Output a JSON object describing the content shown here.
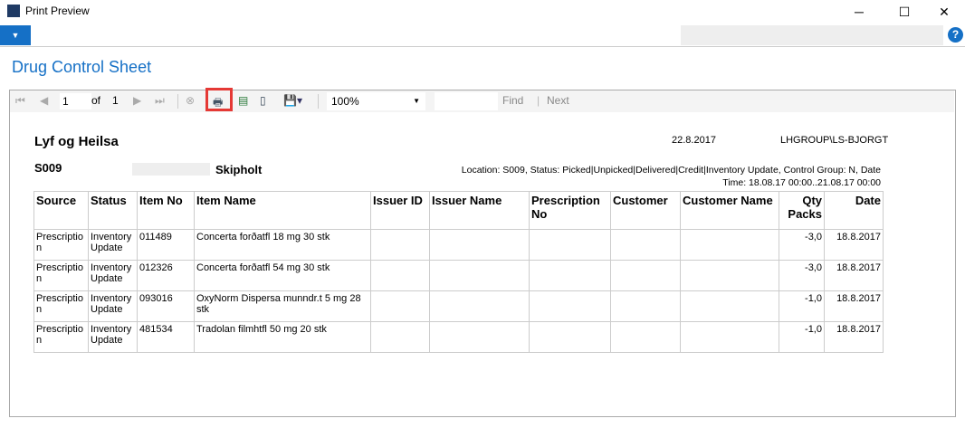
{
  "window": {
    "title": "Print Preview",
    "minimize": "─",
    "maximize": "☐",
    "close": "✕"
  },
  "help_label": "?",
  "page_title": "Drug Control Sheet",
  "toolbar": {
    "page": "1",
    "of_label": "of",
    "total_pages": "1",
    "zoom": "100%",
    "find": "Find",
    "separator": "|",
    "next": "Next"
  },
  "report": {
    "company": "Lyf og Heilsa",
    "date": "22.8.2017",
    "user": "LHGROUP\\LS-BJORGT",
    "store_code": "S009",
    "store_name": "Skipholt",
    "filter_line1": "Location: S009, Status: Picked|Unpicked|Delivered|Credit|Inventory Update, Control Group: N, Date",
    "filter_line2": "Time: 18.08.17 00:00..21.08.17 00:00",
    "headers": [
      "Source",
      "Status",
      "Item No",
      "Item Name",
      "Issuer ID",
      "Issuer Name",
      "Prescription No",
      "Customer",
      "Customer Name",
      "Qty Packs",
      "Date"
    ],
    "rows": [
      [
        "Prescription",
        "Inventory Update",
        "011489",
        "Concerta forðatfl 18 mg 30 stk",
        "",
        "",
        "",
        "",
        "",
        "-3,0",
        "18.8.2017"
      ],
      [
        "Prescription",
        "Inventory Update",
        "012326",
        "Concerta forðatfl 54 mg 30 stk",
        "",
        "",
        "",
        "",
        "",
        "-3,0",
        "18.8.2017"
      ],
      [
        "Prescription",
        "Inventory Update",
        "093016",
        "OxyNorm Dispersa munndr.t 5 mg 28 stk",
        "",
        "",
        "",
        "",
        "",
        "-1,0",
        "18.8.2017"
      ],
      [
        "Prescription",
        "Inventory Update",
        "481534",
        "Tradolan filmhtfl 50 mg 20 stk",
        "",
        "",
        "",
        "",
        "",
        "-1,0",
        "18.8.2017"
      ]
    ]
  }
}
